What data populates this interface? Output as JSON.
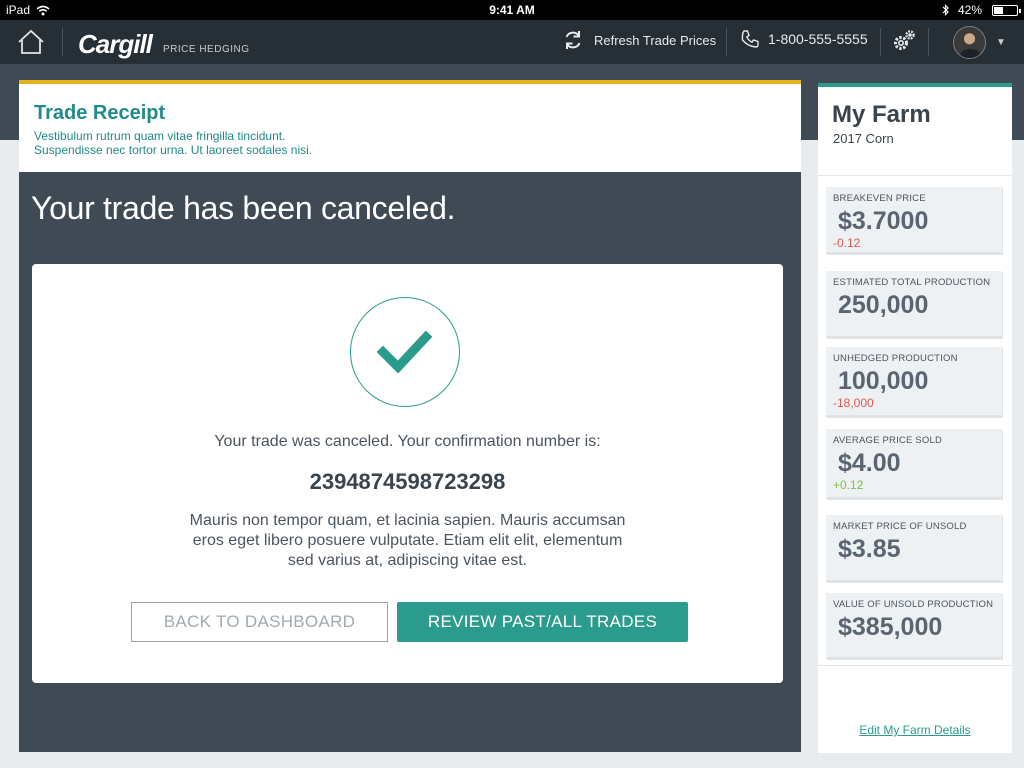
{
  "status_bar": {
    "device": "iPad",
    "time": "9:41 AM",
    "battery": "42%",
    "battery_level": 0.42
  },
  "nav": {
    "logo": "Cargill",
    "logo_sub": "PRICE HEDGING",
    "refresh_label": "Refresh Trade Prices",
    "phone": "1-800-555-5555"
  },
  "receipt": {
    "title": "Trade Receipt",
    "subtitle_line1": "Vestibulum rutrum quam vitae fringilla tincidunt.",
    "subtitle_line2": "Suspendisse nec tortor urna. Ut laoreet sodales nisi.",
    "headline": "Your trade has been canceled."
  },
  "card": {
    "message": "Your trade was canceled. Your confirmation number is:",
    "confirmation_number": "2394874598723298",
    "paragraph": "Mauris non tempor quam, et lacinia sapien. Mauris accumsan eros eget libero posuere vulputate. Etiam elit elit, elementum sed varius at, adipiscing vitae est.",
    "back_button": "BACK TO DASHBOARD",
    "review_button": "REVIEW PAST/ALL TRADES"
  },
  "farm": {
    "title": "My Farm",
    "subtitle": "2017 Corn",
    "stats": [
      {
        "label": "BREAKEVEN PRICE",
        "value": "$3.7000",
        "change": "-0.12"
      },
      {
        "label": "ESTIMATED TOTAL PRODUCTION",
        "value": "250,000",
        "change": ""
      },
      {
        "label": "UNHEDGED PRODUCTION",
        "value": "100,000",
        "change": "-18,000"
      },
      {
        "label": "AVERAGE PRICE SOLD",
        "value": "$4.00",
        "change": "+0.12"
      },
      {
        "label": "MARKET PRICE OF UNSOLD",
        "value": "$3.85",
        "change": ""
      },
      {
        "label": "VALUE OF UNSOLD PRODUCTION",
        "value": "$385,000",
        "change": ""
      }
    ],
    "edit_link": "Edit My Farm Details"
  },
  "colors": {
    "accent_teal": "#2a9b8c",
    "accent_gold": "#e5b21b",
    "negative": "#e2574c",
    "positive": "#7ac143"
  }
}
